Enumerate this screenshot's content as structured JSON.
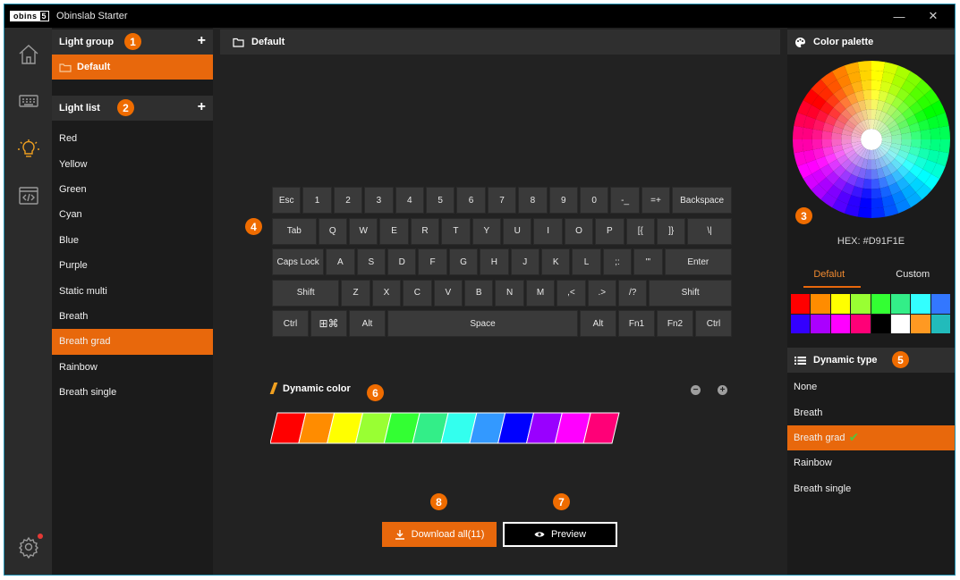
{
  "window": {
    "logo_left": "obins",
    "logo_right": "5",
    "title": "Obinslab Starter",
    "minimize_glyph": "—",
    "close_glyph": "✕"
  },
  "nav": {
    "items": [
      "home-icon",
      "keyboard-icon",
      "lightbulb-icon",
      "code-icon"
    ],
    "active_item": "lightbulb-icon",
    "settings_icon": "gear-icon",
    "active_color": "#f0a020"
  },
  "light_group": {
    "title": "Light group",
    "badge": "1",
    "add_glyph": "+",
    "items": [
      {
        "label": "Default",
        "selected": true
      }
    ]
  },
  "light_list": {
    "title": "Light list",
    "badge": "2",
    "add_glyph": "+",
    "selected_index": 8,
    "items": [
      "Red",
      "Yellow",
      "Green",
      "Cyan",
      "Blue",
      "Purple",
      "Static multi",
      "Breath",
      "Breath grad",
      "Rainbow",
      "Breath single"
    ]
  },
  "center": {
    "header": "Default",
    "keyboard_badge": "4",
    "keyboard_rows": [
      [
        {
          "label": "Esc",
          "w": 1
        },
        {
          "label": "1",
          "w": 1
        },
        {
          "label": "2",
          "w": 1
        },
        {
          "label": "3",
          "w": 1
        },
        {
          "label": "4",
          "w": 1
        },
        {
          "label": "5",
          "w": 1
        },
        {
          "label": "6",
          "w": 1
        },
        {
          "label": "7",
          "w": 1
        },
        {
          "label": "8",
          "w": 1
        },
        {
          "label": "9",
          "w": 1
        },
        {
          "label": "0",
          "w": 1
        },
        {
          "label": "-_",
          "w": 1
        },
        {
          "label": "=+",
          "w": 1
        },
        {
          "label": "Backspace",
          "w": 2
        }
      ],
      [
        {
          "label": "Tab",
          "w": 1.5
        },
        {
          "label": "Q",
          "w": 1
        },
        {
          "label": "W",
          "w": 1
        },
        {
          "label": "E",
          "w": 1
        },
        {
          "label": "R",
          "w": 1
        },
        {
          "label": "T",
          "w": 1
        },
        {
          "label": "Y",
          "w": 1
        },
        {
          "label": "U",
          "w": 1
        },
        {
          "label": "I",
          "w": 1
        },
        {
          "label": "O",
          "w": 1
        },
        {
          "label": "P",
          "w": 1
        },
        {
          "label": "[{",
          "w": 1
        },
        {
          "label": "]}",
          "w": 1
        },
        {
          "label": "\\|",
          "w": 1.5
        }
      ],
      [
        {
          "label": "Caps Lock",
          "w": 1.75
        },
        {
          "label": "A",
          "w": 1
        },
        {
          "label": "S",
          "w": 1
        },
        {
          "label": "D",
          "w": 1
        },
        {
          "label": "F",
          "w": 1
        },
        {
          "label": "G",
          "w": 1
        },
        {
          "label": "H",
          "w": 1
        },
        {
          "label": "J",
          "w": 1
        },
        {
          "label": "K",
          "w": 1
        },
        {
          "label": "L",
          "w": 1
        },
        {
          "label": ";:",
          "w": 1
        },
        {
          "label": "'\"",
          "w": 1
        },
        {
          "label": "Enter",
          "w": 2.25
        }
      ],
      [
        {
          "label": "Shift",
          "w": 2.25
        },
        {
          "label": "Z",
          "w": 1
        },
        {
          "label": "X",
          "w": 1
        },
        {
          "label": "C",
          "w": 1
        },
        {
          "label": "V",
          "w": 1
        },
        {
          "label": "B",
          "w": 1
        },
        {
          "label": "N",
          "w": 1
        },
        {
          "label": "M",
          "w": 1
        },
        {
          "label": ",<",
          "w": 1
        },
        {
          "label": ".>",
          "w": 1
        },
        {
          "label": "/?",
          "w": 1
        },
        {
          "label": "Shift",
          "w": 2.75
        }
      ],
      [
        {
          "label": "Ctrl",
          "w": 1.25
        },
        {
          "label": "win",
          "w": 1.25,
          "icon": "windows-command-icon"
        },
        {
          "label": "Alt",
          "w": 1.25
        },
        {
          "label": "Space",
          "w": 6.25
        },
        {
          "label": "Alt",
          "w": 1.25
        },
        {
          "label": "Fn1",
          "w": 1.25
        },
        {
          "label": "Fn2",
          "w": 1.25
        },
        {
          "label": "Ctrl",
          "w": 1.25
        }
      ]
    ],
    "dynamic_color": {
      "title": "Dynamic color",
      "badge": "6",
      "remove_glyph": "−",
      "add_glyph": "+",
      "swatches": [
        "#ff0000",
        "#ff8c00",
        "#ffff00",
        "#99ff33",
        "#33ff33",
        "#33ee88",
        "#33ffee",
        "#3399ff",
        "#0000ff",
        "#9900ff",
        "#ff00ff",
        "#ff0077"
      ]
    },
    "download_button": {
      "label": "Download all(11)",
      "badge": "8"
    },
    "preview_button": {
      "label": "Preview",
      "badge": "7"
    }
  },
  "color_palette": {
    "title": "Color palette",
    "badge": "3",
    "hex_text": "HEX: #D91F1E",
    "tabs": [
      {
        "label": "Defalut",
        "active": true
      },
      {
        "label": "Custom",
        "active": false
      }
    ],
    "swatches": [
      "#ff0000",
      "#ff8c00",
      "#ffff00",
      "#99ff33",
      "#33ff33",
      "#33ee88",
      "#33ffff",
      "#3377ff",
      "#3300ff",
      "#aa00ff",
      "#ff00ff",
      "#ff0077",
      "#000000",
      "#ffffff",
      "#ff9922",
      "#22bbbb"
    ]
  },
  "dynamic_type": {
    "title": "Dynamic type",
    "badge": "5",
    "selected_index": 2,
    "items": [
      "None",
      "Breath",
      "Breath grad",
      "Rainbow",
      "Breath single"
    ]
  },
  "colors": {
    "accent": "#e8680c",
    "badge": "#ef6c00",
    "check": "#59c13b",
    "settings_dot": "#e53935"
  }
}
